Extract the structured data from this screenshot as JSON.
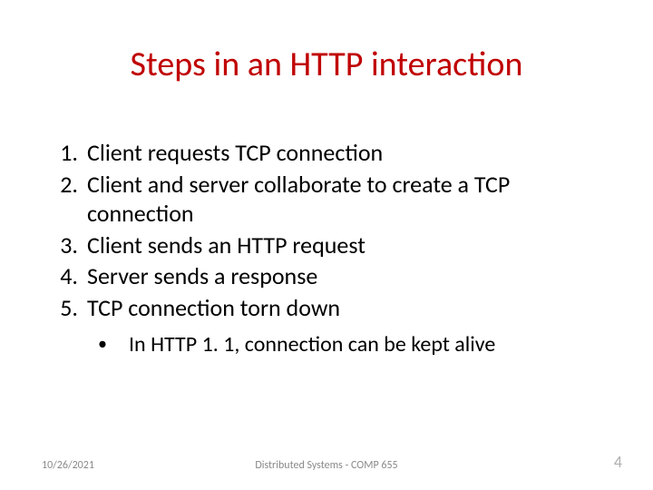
{
  "title": "Steps in an HTTP interaction",
  "items": [
    {
      "n": "1.",
      "t": "Client requests TCP connection"
    },
    {
      "n": "2.",
      "t": "Client and server collaborate to create a TCP connection"
    },
    {
      "n": "3.",
      "t": "Client sends an HTTP request"
    },
    {
      "n": "4.",
      "t": "Server sends a response"
    },
    {
      "n": "5.",
      "t": "TCP connection torn down"
    }
  ],
  "bullet": "In HTTP 1. 1, connection can be kept alive",
  "bullet_mark": "•",
  "footer": {
    "date": "10/26/2021",
    "course": "Distributed Systems - COMP 655",
    "page": "4"
  }
}
